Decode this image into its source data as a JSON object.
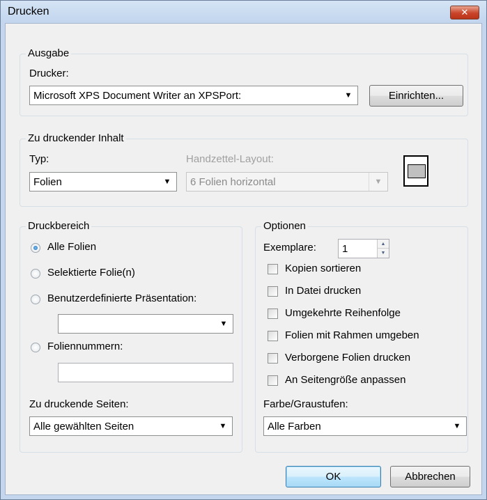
{
  "window": {
    "title": "Drucken",
    "close_glyph": "✕"
  },
  "ausgabe": {
    "legend": "Ausgabe",
    "printer_label": "Drucker:",
    "printer_value": "Microsoft XPS Document Writer an XPSPort:",
    "setup_button": "Einrichten..."
  },
  "content": {
    "legend": "Zu druckender Inhalt",
    "type_label": "Typ:",
    "type_value": "Folien",
    "handout_label": "Handzettel-Layout:",
    "handout_value": "6 Folien horizontal"
  },
  "range": {
    "legend": "Druckbereich",
    "all_slides": "Alle Folien",
    "selected_slides": "Selektierte Folie(n)",
    "custom_show": "Benutzerdefinierte Präsentation:",
    "custom_show_value": "",
    "slide_numbers": "Foliennummern:",
    "slide_numbers_value": "",
    "pages_label": "Zu druckende Seiten:",
    "pages_value": "Alle gewählten Seiten"
  },
  "options": {
    "legend": "Optionen",
    "copies_label": "Exemplare:",
    "copies_value": "1",
    "collate": "Kopien sortieren",
    "print_to_file": "In Datei drucken",
    "reverse_order": "Umgekehrte Reihenfolge",
    "frame_slides": "Folien mit Rahmen umgeben",
    "hidden_slides": "Verborgene Folien drucken",
    "fit_to_page": "An Seitengröße anpassen",
    "color_label": "Farbe/Graustufen:",
    "color_value": "Alle Farben"
  },
  "buttons": {
    "ok": "OK",
    "cancel": "Abbrechen"
  },
  "icons": {
    "dropdown": "▼",
    "spin_up": "▲",
    "spin_down": "▼"
  }
}
